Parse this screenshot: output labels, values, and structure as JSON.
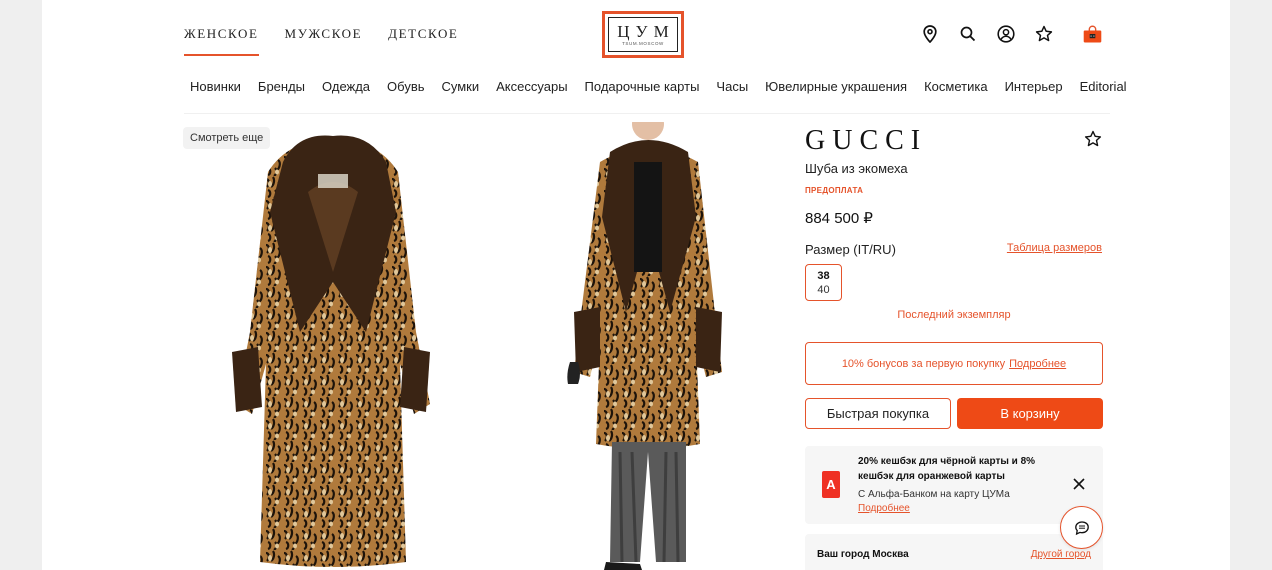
{
  "header": {
    "gender_tabs": [
      "ЖЕНСКОЕ",
      "МУЖСКОЕ",
      "ДЕТСКОЕ"
    ],
    "active_gender": "ЖЕНСКОЕ",
    "logo_text": "ЦУМ",
    "logo_sub": "TSUM.MOSCOW",
    "icons": [
      "location-icon",
      "search-icon",
      "account-icon",
      "favorites-icon",
      "cart-icon"
    ]
  },
  "categories": [
    "Новинки",
    "Бренды",
    "Одежда",
    "Обувь",
    "Сумки",
    "Аксессуары",
    "Подарочные карты",
    "Часы",
    "Ювелирные украшения",
    "Косметика",
    "Интерьер",
    "Editorial"
  ],
  "gallery": {
    "see_more": "Смотреть еще"
  },
  "product": {
    "brand": "GUCCI",
    "name": "Шуба из экомеха",
    "badge": "ПРЕДОПЛАТА",
    "price": "884 500 ₽",
    "size_label": "Размер (IT/RU)",
    "size_table_link": "Таблица размеров",
    "size": {
      "it": "38",
      "ru": "40"
    },
    "last_item": "Последний экземпляр",
    "bonus_text": "10% бонусов за первую покупку",
    "bonus_link": "Подробнее",
    "quick_buy": "Быстрая покупка",
    "add_to_cart": "В корзину"
  },
  "promo": {
    "title": "20% кешбэк для чёрной карты и 8% кешбэк для оранжевой карты",
    "text": "С Альфа-Банком на карту ЦУМа",
    "link": "Подробнее",
    "bank_letter": "А"
  },
  "city": {
    "label": "Ваш город Москва",
    "link": "Другой город"
  },
  "colors": {
    "accent": "#e5532b",
    "cart_button": "#ee4a16",
    "alfa_red": "#ef3124"
  }
}
